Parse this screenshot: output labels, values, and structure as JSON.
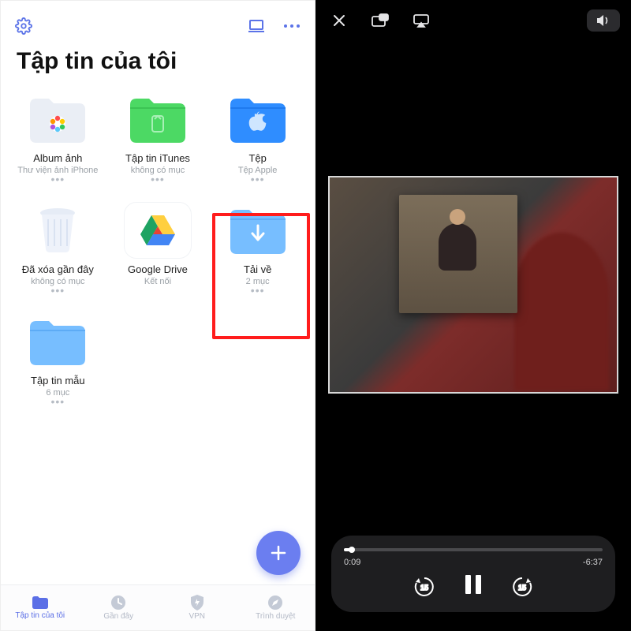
{
  "left": {
    "title": "Tập tin của tôi",
    "items": [
      {
        "key": "album",
        "label": "Album ảnh",
        "sub": "Thư viện ảnh iPhone",
        "thumb": "photos"
      },
      {
        "key": "itunes",
        "label": "Tập tin iTunes",
        "sub": "không có mục",
        "thumb": "folder-green"
      },
      {
        "key": "files",
        "label": "Tệp",
        "sub": "Tệp Apple",
        "thumb": "folder-apple"
      },
      {
        "key": "trash",
        "label": "Đã xóa gần đây",
        "sub": "không có mục",
        "thumb": "trash"
      },
      {
        "key": "gdrive",
        "label": "Google Drive",
        "sub": "Kết nối",
        "thumb": "gdrive"
      },
      {
        "key": "downloads",
        "label": "Tải về",
        "sub": "2 mục",
        "thumb": "folder-download",
        "highlighted": true
      },
      {
        "key": "samples",
        "label": "Tập tin mẫu",
        "sub": "6 mục",
        "thumb": "folder-blue"
      }
    ],
    "nav": [
      {
        "key": "files",
        "label": "Tập tin của tôi",
        "active": true
      },
      {
        "key": "recent",
        "label": "Gần đây"
      },
      {
        "key": "vpn",
        "label": "VPN"
      },
      {
        "key": "browser",
        "label": "Trình duyệt"
      }
    ]
  },
  "right": {
    "elapsed": "0:09",
    "remaining": "-6:37",
    "skip_seconds": "15"
  }
}
